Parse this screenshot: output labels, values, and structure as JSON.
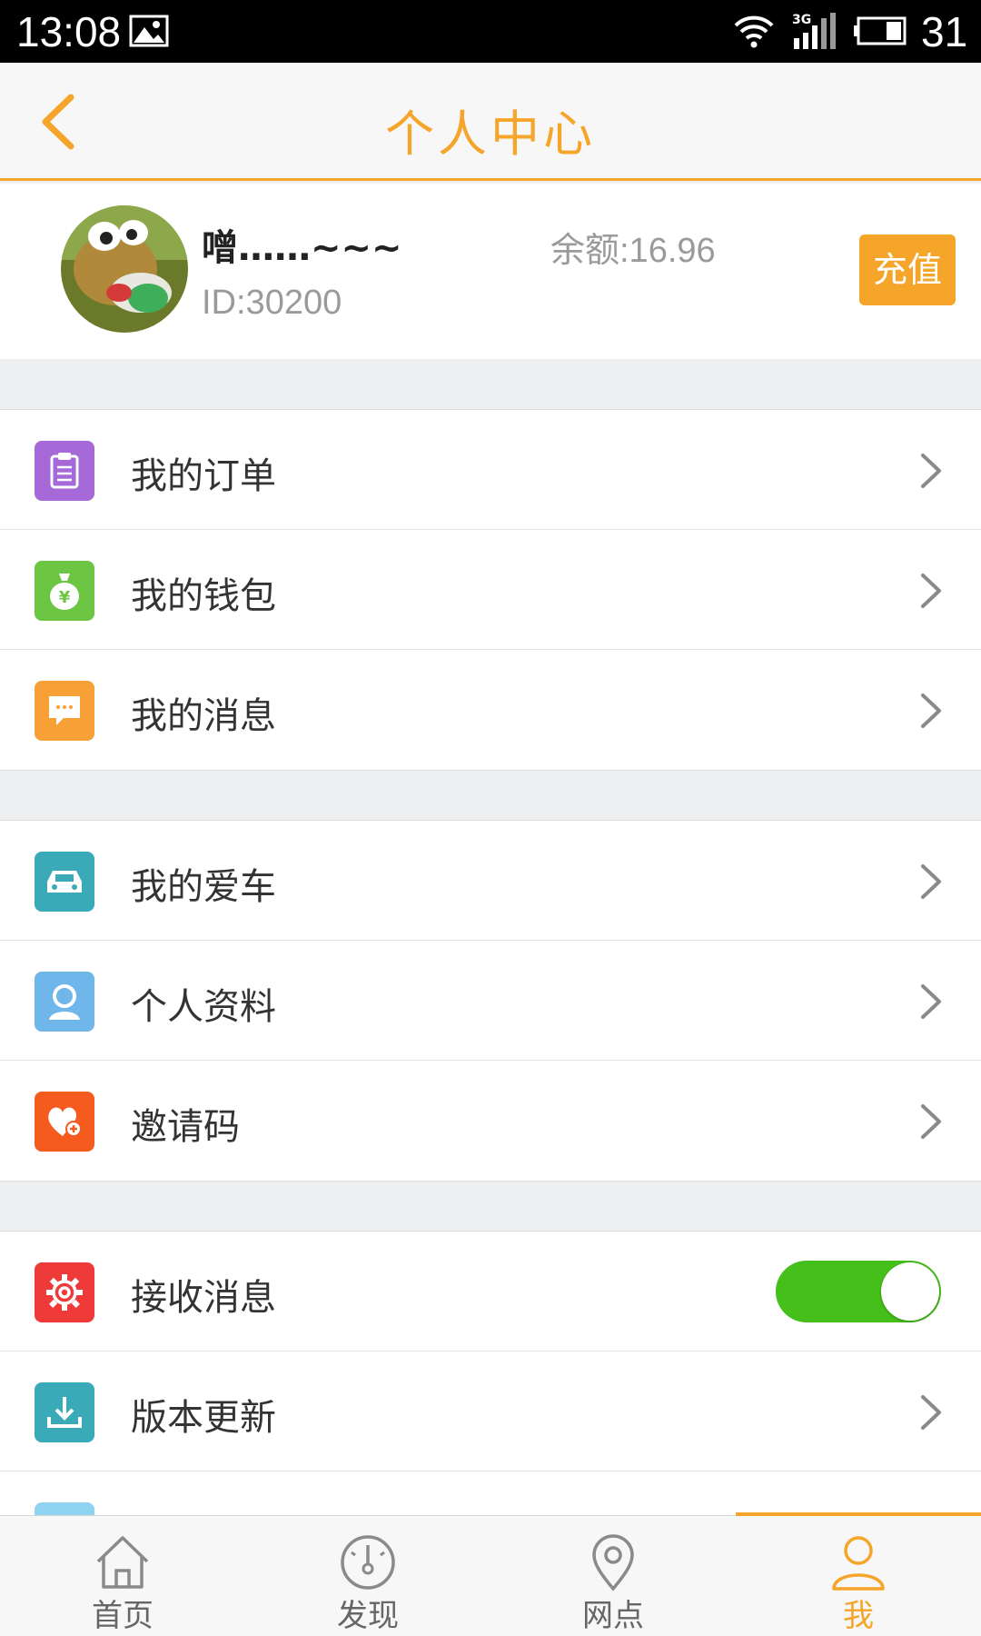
{
  "status_bar": {
    "time": "13:08",
    "network": "3G",
    "battery": "31",
    "icons": [
      "picture-icon",
      "wifi-icon",
      "signal-icon",
      "battery-icon"
    ]
  },
  "header": {
    "title": "个人中心",
    "back_icon": "chevron-left-icon",
    "accent_color": "#f5a52a"
  },
  "profile": {
    "username": "噌……~~~",
    "user_id": "ID:30200",
    "balance": "余额:16.96",
    "recharge_label": "充值"
  },
  "groups": [
    {
      "items": [
        {
          "label": "我的订单",
          "icon": "clipboard-icon",
          "color": "#a56ad8"
        },
        {
          "label": "我的钱包",
          "icon": "money-bag-icon",
          "color": "#6cc644"
        },
        {
          "label": "我的消息",
          "icon": "message-icon",
          "color": "#f7a035"
        }
      ]
    },
    {
      "items": [
        {
          "label": "我的爱车",
          "icon": "car-icon",
          "color": "#3aa9b8"
        },
        {
          "label": "个人资料",
          "icon": "person-icon",
          "color": "#6fb6ea"
        },
        {
          "label": "邀请码",
          "icon": "heart-icon",
          "color": "#f55a1e"
        }
      ]
    },
    {
      "items": [
        {
          "label": "接收消息",
          "icon": "gear-icon",
          "color": "#ef3a3a",
          "toggle": true,
          "toggle_on": true
        },
        {
          "label": "版本更新",
          "icon": "download-icon",
          "color": "#3aa9b8"
        }
      ]
    }
  ],
  "bottom_nav": [
    {
      "label": "首页",
      "icon": "home-icon",
      "active": false
    },
    {
      "label": "发现",
      "icon": "compass-icon",
      "active": false
    },
    {
      "label": "网点",
      "icon": "location-pin-icon",
      "active": false
    },
    {
      "label": "我",
      "icon": "user-icon",
      "active": true
    }
  ]
}
